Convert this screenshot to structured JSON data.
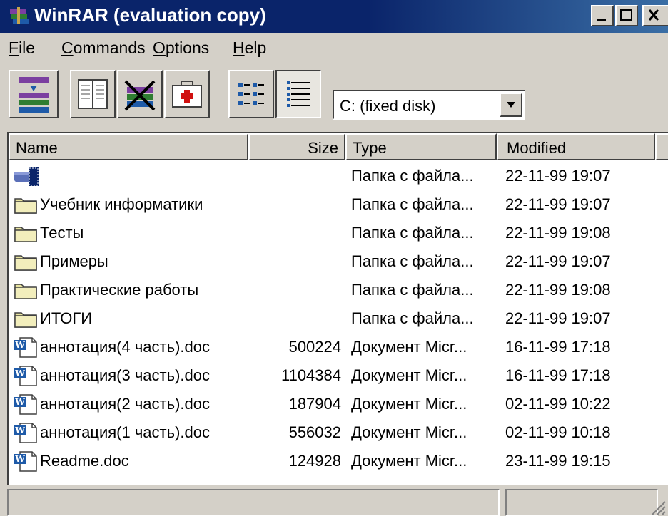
{
  "window": {
    "title": "WinRAR (evaluation copy)"
  },
  "menu": [
    {
      "label": "File",
      "ul": "F",
      "rest": "ile"
    },
    {
      "label": "Commands",
      "ul": "C",
      "rest": "ommands"
    },
    {
      "label": "Options",
      "ul": "O",
      "rest": "ptions"
    },
    {
      "label": "Help",
      "ul": "H",
      "rest": "elp"
    }
  ],
  "toolbar": {
    "buttons": [
      "add-icon",
      "view-icon",
      "delete-icon",
      "repair-icon",
      "list-view-icon",
      "details-view-icon"
    ],
    "drive": "C: (fixed disk)"
  },
  "columns": {
    "name": "Name",
    "size": "Size",
    "type": "Type",
    "modified": "Modified"
  },
  "rows": [
    {
      "icon": "drive-up-icon",
      "name": "",
      "size": "",
      "type": "Папка с файла...",
      "modified": "22-11-99 19:07"
    },
    {
      "icon": "folder-icon",
      "name": "Учебник информатики",
      "size": "",
      "type": "Папка с файла...",
      "modified": "22-11-99 19:07"
    },
    {
      "icon": "folder-icon",
      "name": "Тесты",
      "size": "",
      "type": "Папка с файла...",
      "modified": "22-11-99 19:08"
    },
    {
      "icon": "folder-icon",
      "name": "Примеры",
      "size": "",
      "type": "Папка с файла...",
      "modified": "22-11-99 19:07"
    },
    {
      "icon": "folder-icon",
      "name": "Практические работы",
      "size": "",
      "type": "Папка с файла...",
      "modified": "22-11-99 19:08"
    },
    {
      "icon": "folder-icon",
      "name": "ИТОГИ",
      "size": "",
      "type": "Папка с файла...",
      "modified": "22-11-99 19:07"
    },
    {
      "icon": "word-doc-icon",
      "name": "аннотация(4 часть).doc",
      "size": "500224",
      "type": "Документ Micr...",
      "modified": "16-11-99 17:18"
    },
    {
      "icon": "word-doc-icon",
      "name": "аннотация(3 часть).doc",
      "size": "1104384",
      "type": "Документ Micr...",
      "modified": "16-11-99 17:18"
    },
    {
      "icon": "word-doc-icon",
      "name": "аннотация(2 часть).doc",
      "size": "187904",
      "type": "Документ Micr...",
      "modified": "02-11-99 10:22"
    },
    {
      "icon": "word-doc-icon",
      "name": "аннотация(1 часть).doc",
      "size": "556032",
      "type": "Документ Micr...",
      "modified": "02-11-99 10:18"
    },
    {
      "icon": "word-doc-icon",
      "name": "Readme.doc",
      "size": "124928",
      "type": "Документ Micr...",
      "modified": "23-11-99 19:15"
    }
  ],
  "colors": {
    "titlebar": "#0a246a",
    "face": "#d4d0c8",
    "folder": "#e8e4a0"
  }
}
